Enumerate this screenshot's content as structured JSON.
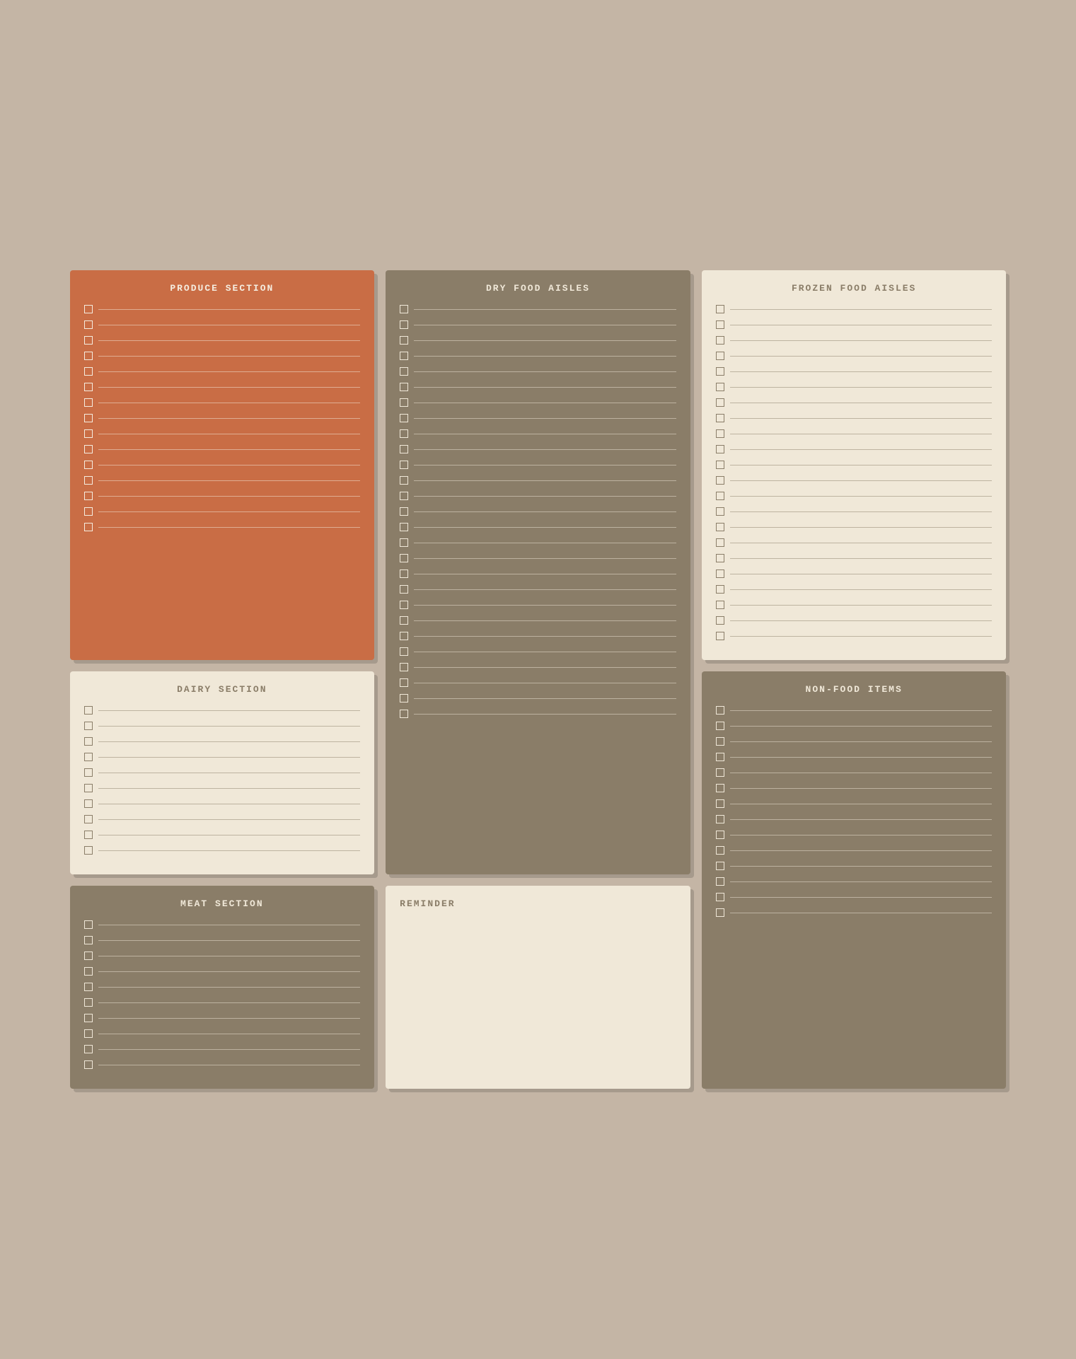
{
  "sections": {
    "produce": {
      "title": "PRODUCE SECTION",
      "items": 15
    },
    "dry_food": {
      "title": "DRY FOOD AISLES",
      "items": 27
    },
    "frozen_food": {
      "title": "FROZEN FOOD AISLES",
      "items": 22
    },
    "dairy": {
      "title": "DAIRY SECTION",
      "items": 10
    },
    "non_food": {
      "title": "NON-FOOD ITEMS",
      "items": 14
    },
    "meat": {
      "title": "MEAT SECTION",
      "items": 10
    },
    "reminder": {
      "title": "REMINDER"
    }
  }
}
